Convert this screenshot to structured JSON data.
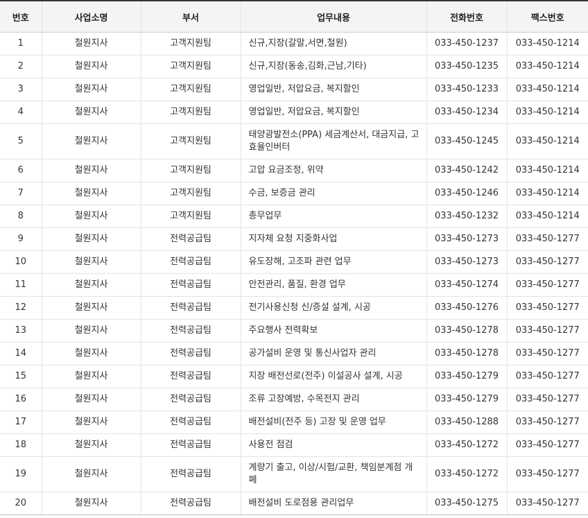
{
  "headers": [
    "번호",
    "사업소명",
    "부서",
    "업무내용",
    "전화번호",
    "팩스번호"
  ],
  "rows": [
    {
      "no": "1",
      "office": "철원지사",
      "dept": "고객지원팀",
      "work": "신규,지장(갈말,서면,철원)",
      "tel": "033-450-1237",
      "fax": "033-450-1214"
    },
    {
      "no": "2",
      "office": "철원지사",
      "dept": "고객지원팀",
      "work": "신규,지장(동송,김화,근남,기타)",
      "tel": "033-450-1235",
      "fax": "033-450-1214"
    },
    {
      "no": "3",
      "office": "철원지사",
      "dept": "고객지원팀",
      "work": "영업일반, 저압요금, 복지할인",
      "tel": "033-450-1233",
      "fax": "033-450-1214"
    },
    {
      "no": "4",
      "office": "철원지사",
      "dept": "고객지원팀",
      "work": "영업일반, 저압요금, 복지할인",
      "tel": "033-450-1234",
      "fax": "033-450-1214"
    },
    {
      "no": "5",
      "office": "철원지사",
      "dept": "고객지원팀",
      "work": "태양광발전소(PPA) 세금계산서, 대금지급, 고효율인버터",
      "tel": "033-450-1245",
      "fax": "033-450-1214"
    },
    {
      "no": "6",
      "office": "철원지사",
      "dept": "고객지원팀",
      "work": "고압 요금조정, 위약",
      "tel": "033-450-1242",
      "fax": "033-450-1214"
    },
    {
      "no": "7",
      "office": "철원지사",
      "dept": "고객지원팀",
      "work": "수금, 보증금 관리",
      "tel": "033-450-1246",
      "fax": "033-450-1214"
    },
    {
      "no": "8",
      "office": "철원지사",
      "dept": "고객지원팀",
      "work": "총무업무",
      "tel": "033-450-1232",
      "fax": "033-450-1214"
    },
    {
      "no": "9",
      "office": "철원지사",
      "dept": "전력공급팀",
      "work": "지자체 요청 지중화사업",
      "tel": "033-450-1273",
      "fax": "033-450-1277"
    },
    {
      "no": "10",
      "office": "철원지사",
      "dept": "전력공급팀",
      "work": "유도장해, 고조파 관련 업무",
      "tel": "033-450-1273",
      "fax": "033-450-1277"
    },
    {
      "no": "11",
      "office": "철원지사",
      "dept": "전력공급팀",
      "work": "안전관리, 품질, 환경 업무",
      "tel": "033-450-1274",
      "fax": "033-450-1277"
    },
    {
      "no": "12",
      "office": "철원지사",
      "dept": "전력공급팀",
      "work": "전기사용신청 신/증설 설계, 시공",
      "tel": "033-450-1276",
      "fax": "033-450-1277"
    },
    {
      "no": "13",
      "office": "철원지사",
      "dept": "전력공급팀",
      "work": "주요행사 전력확보",
      "tel": "033-450-1278",
      "fax": "033-450-1277"
    },
    {
      "no": "14",
      "office": "철원지사",
      "dept": "전력공급팀",
      "work": "공가설비 운영 및 통신사업자 관리",
      "tel": "033-450-1278",
      "fax": "033-450-1277"
    },
    {
      "no": "15",
      "office": "철원지사",
      "dept": "전력공급팀",
      "work": "지장 배전선로(전주) 이설공사 설계, 시공",
      "tel": "033-450-1279",
      "fax": "033-450-1277"
    },
    {
      "no": "16",
      "office": "철원지사",
      "dept": "전력공급팀",
      "work": "조류 고장예방, 수목전지 관리",
      "tel": "033-450-1279",
      "fax": "033-450-1277"
    },
    {
      "no": "17",
      "office": "철원지사",
      "dept": "전력공급팀",
      "work": "배전설비(전주 등) 고장 및 운영 업무",
      "tel": "033-450-1288",
      "fax": "033-450-1277"
    },
    {
      "no": "18",
      "office": "철원지사",
      "dept": "전력공급팀",
      "work": "사용전 점검",
      "tel": "033-450-1272",
      "fax": "033-450-1277"
    },
    {
      "no": "19",
      "office": "철원지사",
      "dept": "전력공급팀",
      "work": "계량기 출고, 이상/시험/교환, 책임분계점 개폐",
      "tel": "033-450-1272",
      "fax": "033-450-1277"
    },
    {
      "no": "20",
      "office": "철원지사",
      "dept": "전력공급팀",
      "work": "배전설비 도로점용 관리업무",
      "tel": "033-450-1275",
      "fax": "033-450-1277"
    }
  ]
}
